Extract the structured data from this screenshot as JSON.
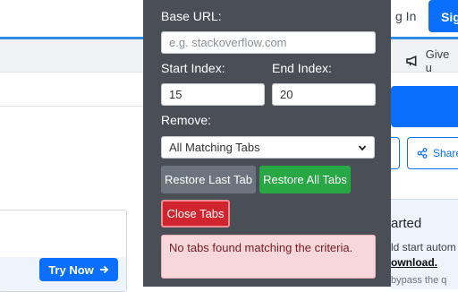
{
  "background": {
    "login_text": "g In",
    "signup_text": "Sig",
    "give_text": "Give u",
    "share_text": "Share",
    "card_right": {
      "title": "arted",
      "line1": "ld start autom",
      "link": "ownload.",
      "line3": "bypass the q"
    },
    "try_now_label": "Try Now"
  },
  "popup": {
    "base_url_label": "Base URL:",
    "base_url_value": "",
    "base_url_placeholder": "e.g. stackoverflow.com",
    "start_index_label": "Start Index:",
    "start_index_value": "15",
    "end_index_label": "End Index:",
    "end_index_value": "20",
    "remove_label": "Remove:",
    "remove_selected": "All Matching Tabs",
    "restore_last_label": "Restore Last Tab",
    "restore_all_label": "Restore All Tabs",
    "close_tabs_label": "Close Tabs",
    "alert_text": "No tabs found matching the criteria."
  },
  "colors": {
    "popup_bg": "#4a4f57",
    "primary": "#0a6ffc",
    "gray_button": "#6c757d",
    "green_button": "#28a745",
    "red_button": "#d0242f",
    "alert_bg": "#f8d7da",
    "alert_text": "#721c24"
  },
  "icons": [
    "megaphone-icon",
    "share-icon",
    "arrow-right-icon",
    "chevron-down-icon",
    "extension-icon"
  ]
}
